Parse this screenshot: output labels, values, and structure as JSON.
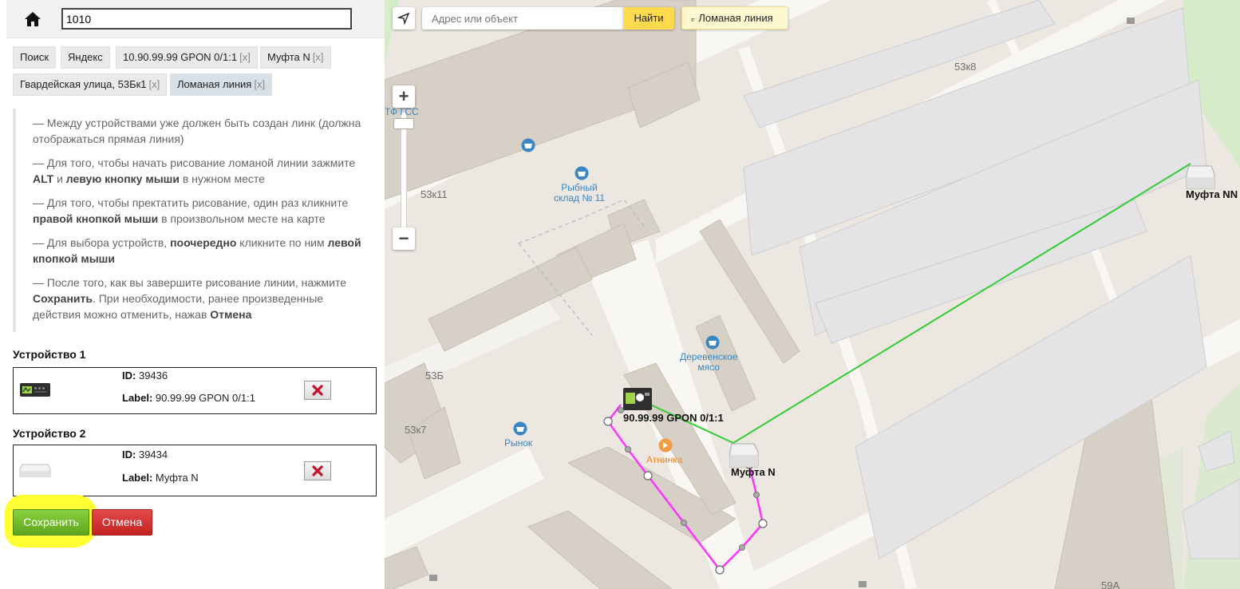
{
  "header": {
    "search_value": "1010"
  },
  "tabs": [
    {
      "label": "Поиск",
      "close": ""
    },
    {
      "label": "Яндекс",
      "close": ""
    },
    {
      "label": "10.90.99.99 GPON 0/1:1",
      "close": "[x]"
    },
    {
      "label": "Муфта N",
      "close": "[x]"
    },
    {
      "label": "Гвардейская улица, 53Бк1",
      "close": "[x]"
    },
    {
      "label": "Ломаная линия",
      "close": "[x]"
    }
  ],
  "instructions": {
    "p1": "— Между устройствами уже должен быть создан линк (должна отображаться прямая линия)",
    "p2_a": "— Для того, чтобы начать рисование ломаной линии зажмите ",
    "p2_b1": "ALT",
    "p2_c": " и ",
    "p2_b2": "левую кнопку мыши",
    "p2_d": " в нужном месте",
    "p3_a": "— Для того, чтобы пректатить рисование, один раз кликните ",
    "p3_b": "правой кнопкой мыши",
    "p3_c": " в произвольном месте на карте",
    "p4_a": "— Для выбора устройств, ",
    "p4_b": "поочередно",
    "p4_c": " кликните по ним ",
    "p4_d": "левой кпопкой мыши",
    "p5_a": "— После того, как вы завершите рисование линии, нажмите ",
    "p5_b": "Сохранить",
    "p5_c": ". При необходимости, ранее произведенные действия можно отменить, нажав ",
    "p5_d": "Отмена"
  },
  "device1": {
    "title": "Устройство 1",
    "id_label": "ID:",
    "id": "39436",
    "label_label": "Label:",
    "label": "90.99.99 GPON 0/1:1",
    "icon": "gpon-device-icon"
  },
  "device2": {
    "title": "Устройство 2",
    "id_label": "ID:",
    "id": "39434",
    "label_label": "Label:",
    "label": "Муфта N",
    "icon": "coupler-icon"
  },
  "buttons": {
    "save": "Сохранить",
    "cancel": "Отмена"
  },
  "map": {
    "search_placeholder": "Адрес или объект",
    "find": "Найти",
    "polyline": "Ломаная линия",
    "polyline_icon": "polyline-icon",
    "zoom_in": "+",
    "zoom_out": "−",
    "labels": {
      "b53k8": "53к8",
      "b53k11": "53к11",
      "b53b": "53Б",
      "b53k7": "53к7",
      "b59a": "59А",
      "tfgss": "ТФ ГСС"
    },
    "pois": {
      "fish_line1": "Рыбный",
      "fish_line2": "склад № 11",
      "meat_line1": "Деревенское",
      "meat_line2": "мясо",
      "market": "Рынок",
      "atninka": "Атнинка"
    },
    "devices": {
      "gpon": "90.99.99 GPON 0/1:1",
      "mufta_n": "Муфта N",
      "mufta_nn": "Муфта NN"
    }
  },
  "colors": {
    "link_line": "#33cc33",
    "polyline": "#ff33ff",
    "highlight": "#ffff33",
    "save": "#6cb62a",
    "cancel": "#d23232",
    "find_button": "#ffdb4d"
  }
}
